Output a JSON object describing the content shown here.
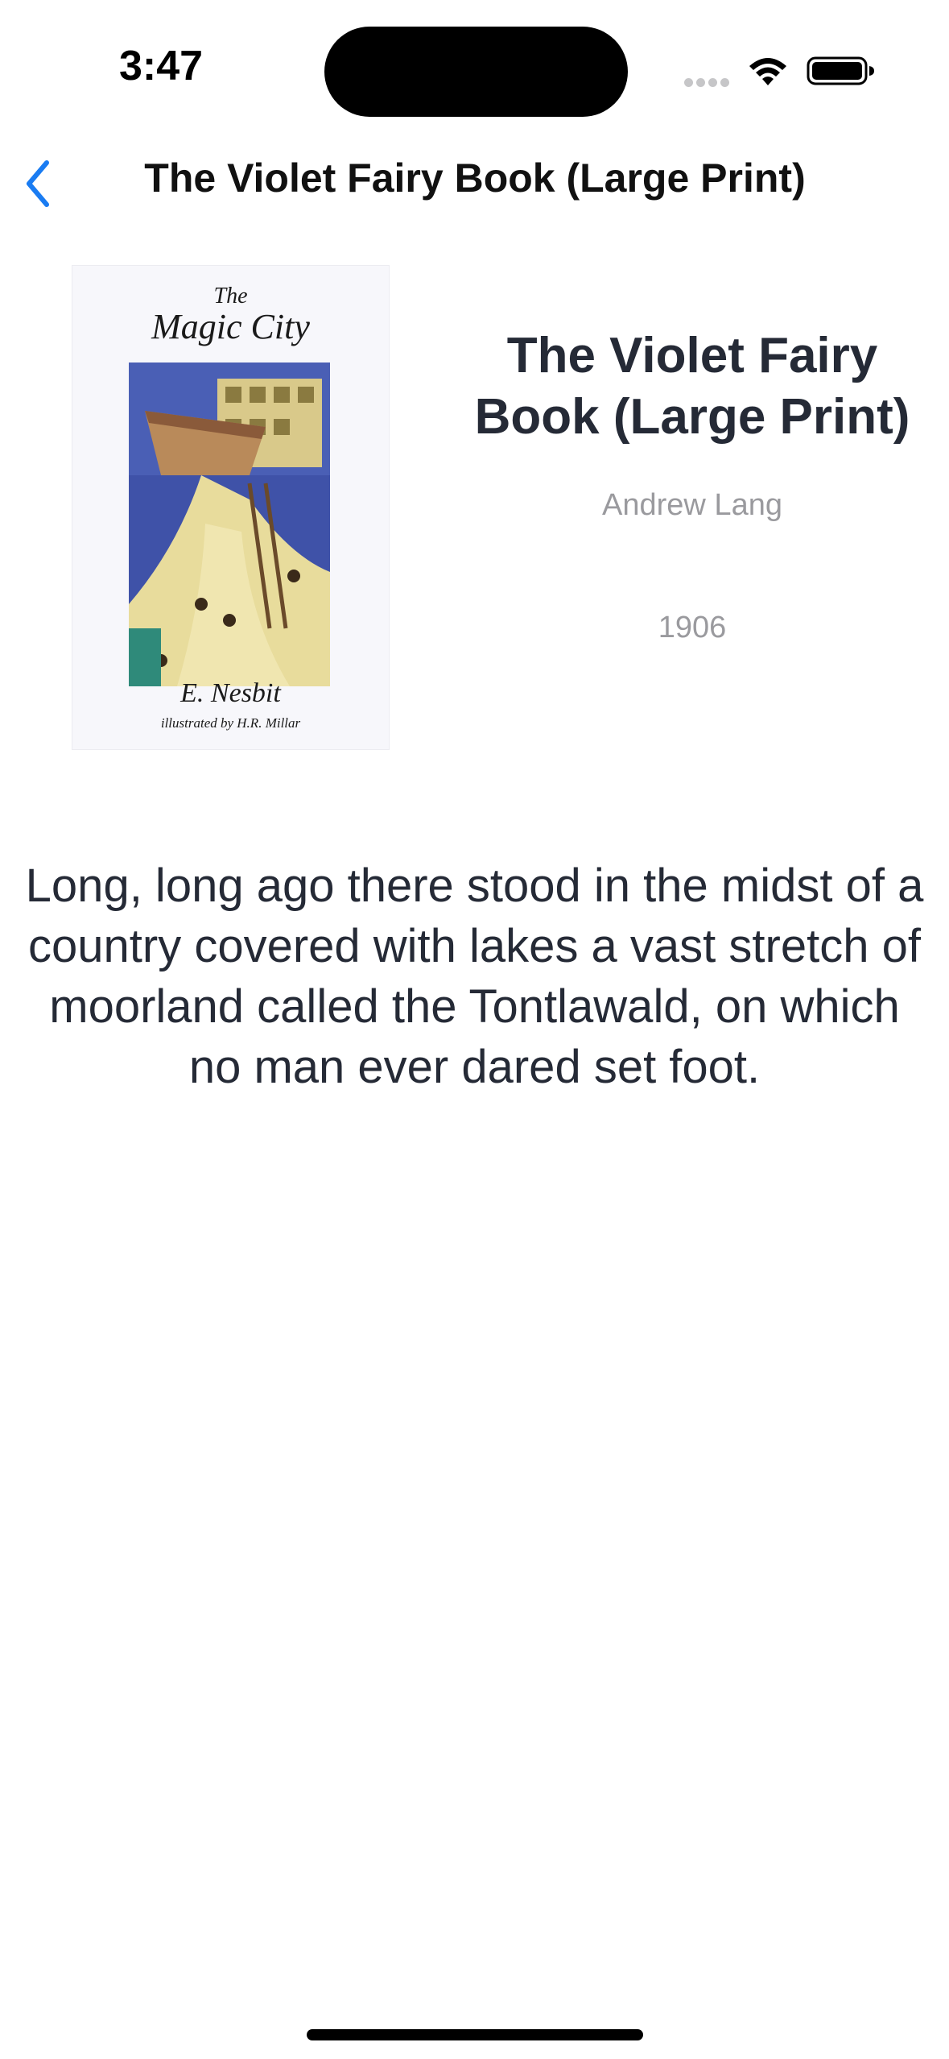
{
  "status_bar": {
    "time": "3:47"
  },
  "nav": {
    "title": "The Violet Fairy Book (Large Print)",
    "back_icon": "chevron-left-icon",
    "accent_color": "#1a7cf2"
  },
  "cover": {
    "the": "The",
    "title": "Magic City",
    "author": "E. Nesbit",
    "illustrator": "illustrated by H.R. Millar"
  },
  "book": {
    "title": "The Violet Fairy Book (Large Print)",
    "author": "Andrew Lang",
    "year": "1906",
    "description": "Long, long ago there stood in the midst of a country covered with lakes a vast stretch of moorland called the Tontlawald, on which no man ever dared set foot."
  }
}
